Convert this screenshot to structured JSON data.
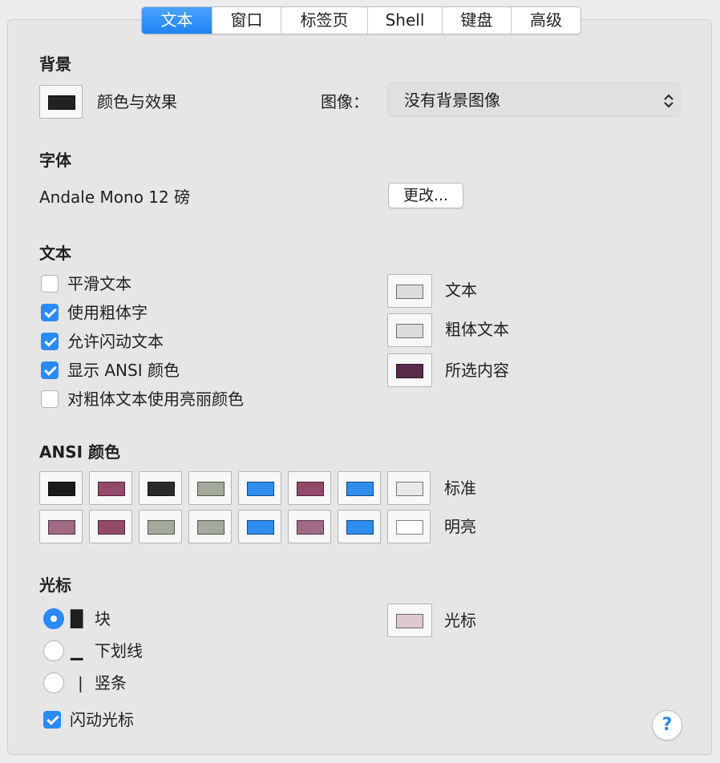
{
  "tabs": [
    "文本",
    "窗口",
    "标签页",
    "Shell",
    "键盘",
    "高级"
  ],
  "background": {
    "heading": "背景",
    "color_effect_label": "颜色与效果",
    "swatch_color": "#222222",
    "image_label": "图像：",
    "image_value": "没有背景图像"
  },
  "font": {
    "heading": "字体",
    "value": "Andale Mono 12 磅",
    "change_label": "更改..."
  },
  "text": {
    "heading": "文本",
    "options": [
      {
        "label": "平滑文本",
        "checked": false
      },
      {
        "label": "使用粗体字",
        "checked": true
      },
      {
        "label": "允许闪动文本",
        "checked": true
      },
      {
        "label": "显示 ANSI 颜色",
        "checked": true
      },
      {
        "label": "对粗体文本使用亮丽颜色",
        "checked": false
      }
    ],
    "colors": [
      {
        "label": "文本",
        "color": "#dcdcdc"
      },
      {
        "label": "粗体文本",
        "color": "#dcdcdc"
      },
      {
        "label": "所选内容",
        "color": "#5a2a4a"
      }
    ]
  },
  "ansi": {
    "heading": "ANSI 颜色",
    "normal_label": "标准",
    "bright_label": "明亮",
    "normal": [
      "#1a1a1a",
      "#954a6b",
      "#2a2a2a",
      "#a3aa9b",
      "#2f8df0",
      "#954a6b",
      "#2f8df0",
      "#e9e9e9"
    ],
    "bright": [
      "#a06a85",
      "#954a6b",
      "#a3aa9b",
      "#a3aa9b",
      "#2f8df0",
      "#a06a85",
      "#2f8df0",
      "#ffffff"
    ]
  },
  "cursor": {
    "heading": "光标",
    "options": [
      {
        "glyph": "█",
        "label": "块",
        "selected": true
      },
      {
        "glyph": "▁",
        "label": "下划线",
        "selected": false
      },
      {
        "glyph": "❘",
        "label": "竖条",
        "selected": false
      }
    ],
    "blink_label": "闪动光标",
    "blink_checked": true,
    "color_label": "光标",
    "color": "#dcc9d0"
  },
  "help_label": "?"
}
